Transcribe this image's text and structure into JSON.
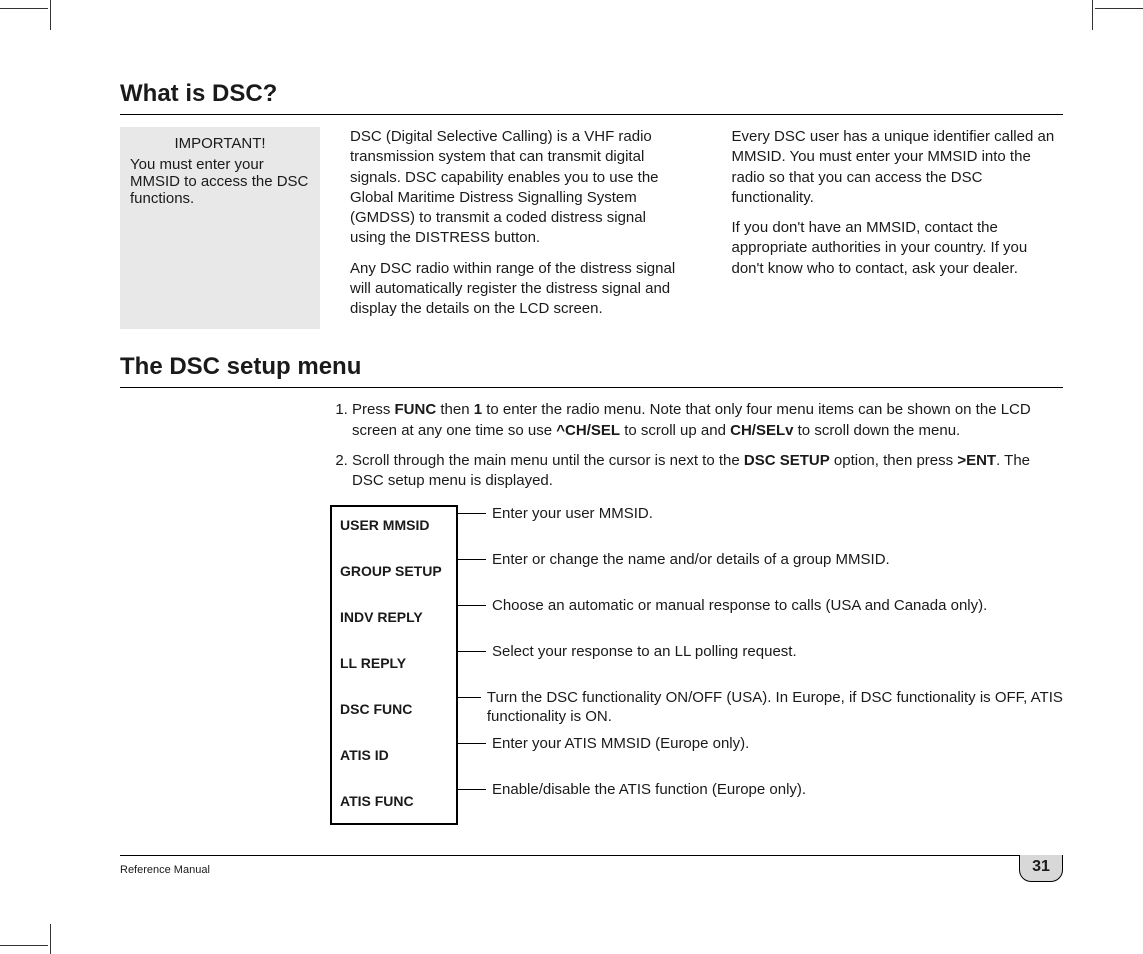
{
  "section1": {
    "heading": "What is DSC?",
    "important": {
      "title": "IMPORTANT!",
      "body": "You must enter your MMSID to access the DSC functions."
    },
    "col1": {
      "p1": "DSC (Digital Selective Calling) is a VHF radio transmission system that can transmit digital signals. DSC capability enables you to use the Global Maritime Distress Signalling System (GMDSS) to transmit a coded distress signal using the DISTRESS button.",
      "p2": "Any DSC radio within range of the distress signal will automatically register the distress signal and display the details on the LCD screen."
    },
    "col2": {
      "p1": "Every DSC user has a unique identifier called an MMSID. You must enter your MMSID into the radio so that you can access the DSC functionality.",
      "p2": "If you don't have an MMSID, contact the appropriate authorities in your country. If you don't know who to contact, ask your dealer."
    }
  },
  "section2": {
    "heading": "The DSC setup menu",
    "step1": {
      "pre": "Press ",
      "b1": "FUNC",
      "mid1": " then ",
      "b2": "1",
      "mid2": " to enter the radio menu. Note that only four menu items can be shown on the LCD screen at any one time so use ",
      "b3": "^CH/SEL",
      "mid3": " to scroll up and ",
      "b4": "CH/SELv",
      "post": " to scroll down the menu."
    },
    "step2": {
      "pre": "Scroll through the main menu until the cursor is next to the ",
      "b1": "DSC SETUP",
      "mid1": " option, then press ",
      "b2": ">ENT",
      "post": ". The DSC setup menu is displayed."
    },
    "menu": [
      {
        "label": "USER MMSID",
        "desc": "Enter your user MMSID."
      },
      {
        "label": "GROUP SETUP",
        "desc": "Enter or change the name and/or details of a group MMSID."
      },
      {
        "label": "INDV REPLY",
        "desc": "Choose an automatic or manual response to calls (USA and Canada only)."
      },
      {
        "label": "LL REPLY",
        "desc": "Select your response to an LL polling request."
      },
      {
        "label": "DSC FUNC",
        "desc": "Turn the DSC functionality ON/OFF (USA). In Europe, if DSC functionality is OFF, ATIS functionality is ON."
      },
      {
        "label": "ATIS ID",
        "desc": "Enter your ATIS MMSID (Europe only)."
      },
      {
        "label": "ATIS FUNC",
        "desc": "Enable/disable the ATIS function (Europe only)."
      }
    ]
  },
  "footer": {
    "label": "Reference Manual",
    "page": "31"
  }
}
